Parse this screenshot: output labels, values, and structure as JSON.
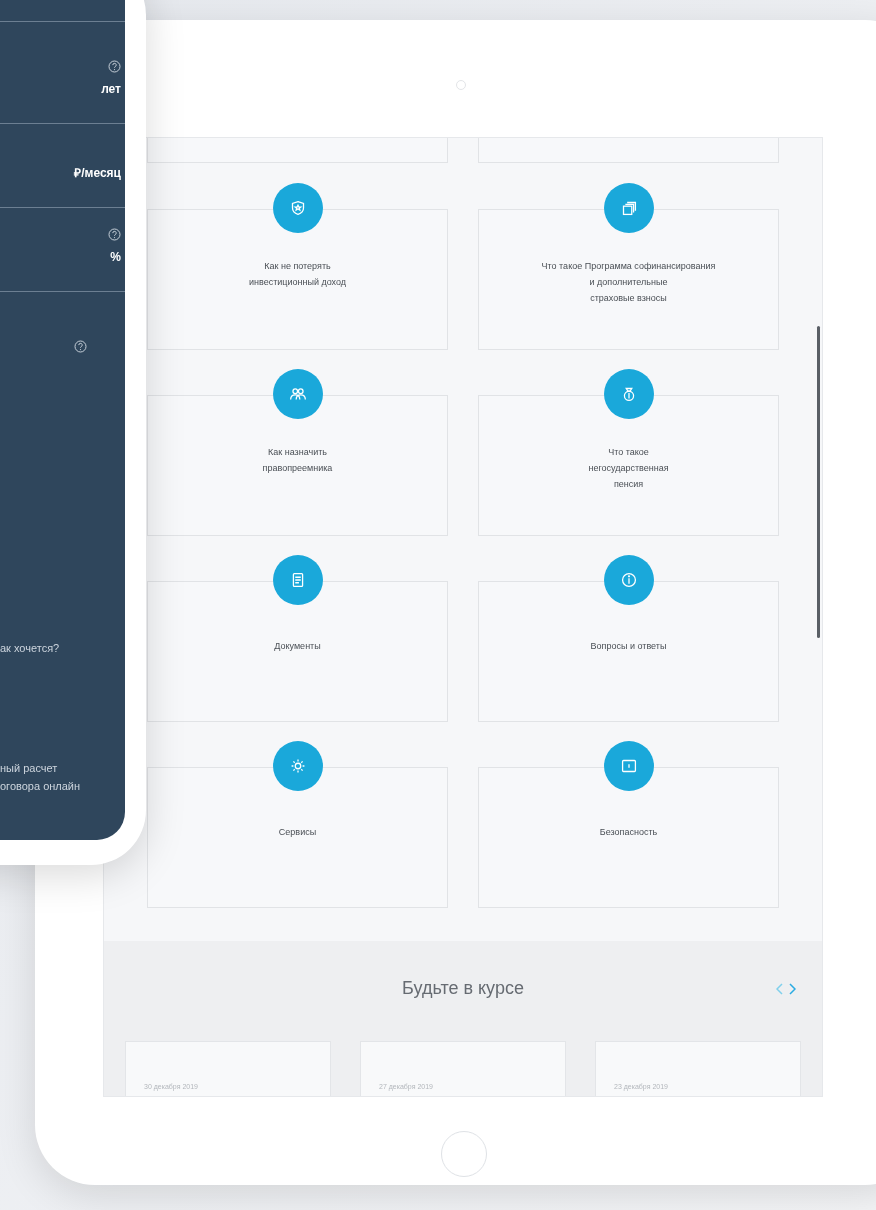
{
  "phone": {
    "fields": [
      {
        "unit": "лет",
        "help": true
      },
      {
        "unit": "₽/месяц",
        "help": false
      },
      {
        "unit": "%",
        "help": true
      }
    ],
    "help_icon": true,
    "question": "ак хочется?",
    "caption_lines": [
      "ный расчет",
      "оговора онлайн"
    ]
  },
  "tablet": {
    "topics": [
      {
        "lines": [
          "Как не потерять",
          "инвестиционный доход"
        ]
      },
      {
        "lines": [
          "Что такое Программа софинансирования",
          "и дополнительные",
          "страховые взносы"
        ]
      },
      {
        "lines": [
          "Как назначить",
          "правопреемника"
        ]
      },
      {
        "lines": [
          "Что такое",
          "негосударственная",
          "пенсия"
        ]
      },
      {
        "lines": [
          "Документы"
        ]
      },
      {
        "lines": [
          "Вопросы и ответы"
        ]
      },
      {
        "lines": [
          "Сервисы"
        ]
      },
      {
        "lines": [
          "Безопасность"
        ]
      }
    ],
    "news": {
      "title": "Будьте в курсе",
      "dates": [
        "30 декабря 2019",
        "27 декабря 2019",
        "23 декабря 2019"
      ]
    }
  }
}
